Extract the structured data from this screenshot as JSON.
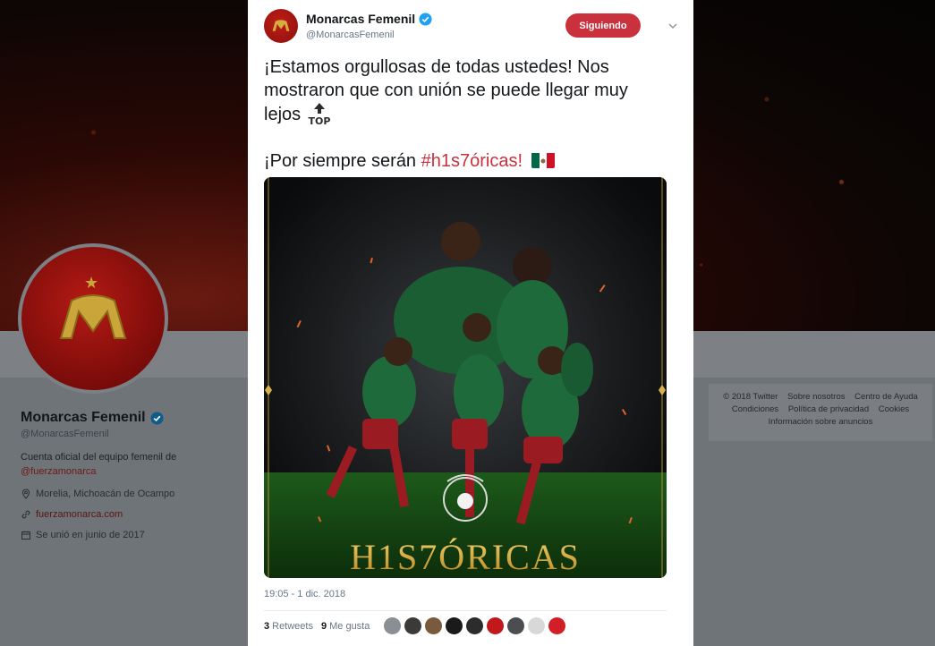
{
  "profile": {
    "name": "Monarcas Femenil",
    "handle": "@MonarcasFemenil",
    "bio_text": "Cuenta oficial del equipo femenil de",
    "bio_link": "@fuerzamonarca",
    "location": "Morelia, Michoacán de Ocampo",
    "website": "fuerzamonarca.com",
    "joined": "Se unió en junio de 2017"
  },
  "footer": {
    "line1": [
      "© 2018 Twitter",
      "Sobre nosotros",
      "Centro de Ayuda"
    ],
    "line2": [
      "Condiciones",
      "Política de privacidad",
      "Cookies"
    ],
    "line3": "Información sobre anuncios"
  },
  "tweet": {
    "author_name": "Monarcas Femenil",
    "author_handle": "@MonarcasFemenil",
    "follow_label": "Siguiendo",
    "text_line1": "¡Estamos orgullosas de todas ustedes! Nos mostraron que con unión se puede llegar muy lejos",
    "text_line2_prefix": "¡Por siempre serán",
    "hashtag": "#h1s7óricas",
    "text_line2_suffix": "!",
    "image_title": "H1S7ÓRICAS",
    "timestamp": "19:05 - 1 dic. 2018",
    "retweets_count": "3",
    "retweets_label": "Retweets",
    "likes_count": "9",
    "likes_label": "Me gusta",
    "likers": [
      "#8a8f94",
      "#3b3a38",
      "#7a5a3c",
      "#1a1a1a",
      "#2c2c2c",
      "#c0181b",
      "#4b4d50",
      "#d8d8d8",
      "#d11f27"
    ]
  },
  "icons": {
    "verified": "verified-badge-icon",
    "chevron": "chevron-down-icon",
    "location": "location-pin-icon",
    "link": "link-icon",
    "calendar": "calendar-icon"
  },
  "colors": {
    "accent": "#c9313d",
    "link_dim": "#6e1a15",
    "verified": "#1da1f2"
  }
}
